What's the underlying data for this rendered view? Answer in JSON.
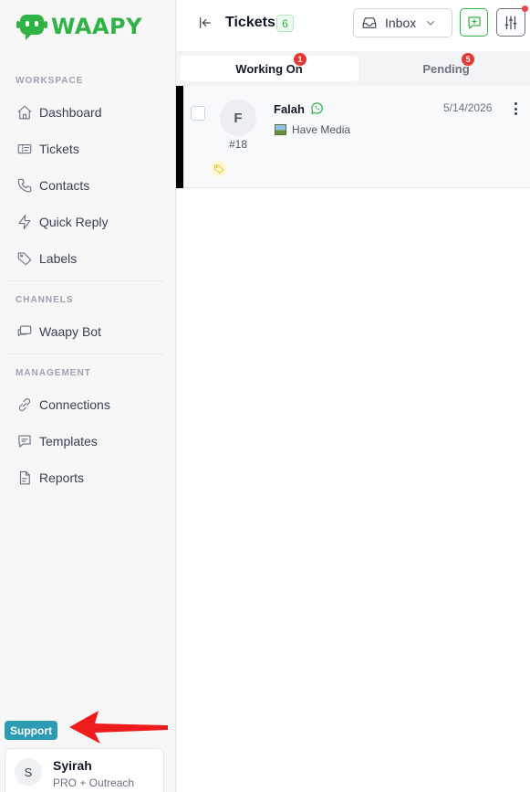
{
  "app": {
    "logo_text": "WAAPY",
    "brand_color": "#2fb344"
  },
  "sidebar": {
    "sections": {
      "workspace": "WORKSPACE",
      "channels": "CHANNELS",
      "management": "MANAGEMENT"
    },
    "items": [
      {
        "label": "Dashboard",
        "icon": "home-icon"
      },
      {
        "label": "Tickets",
        "icon": "ticket-icon"
      },
      {
        "label": "Contacts",
        "icon": "phone-icon"
      },
      {
        "label": "Quick Reply",
        "icon": "lightning-icon"
      },
      {
        "label": "Labels",
        "icon": "tag-icon"
      },
      {
        "label": "Waapy Bot",
        "icon": "bot-chat-icon"
      },
      {
        "label": "Connections",
        "icon": "link-icon"
      },
      {
        "label": "Templates",
        "icon": "message-template-icon"
      },
      {
        "label": "Reports",
        "icon": "document-icon"
      }
    ],
    "support_label": "Support",
    "user": {
      "initial": "S",
      "name": "Syirah",
      "plan": "PRO + Outreach"
    }
  },
  "header": {
    "title": "Tickets",
    "count": "6",
    "inbox_label": "Inbox"
  },
  "tabs": [
    {
      "label": "Working On",
      "count": "1",
      "active": true
    },
    {
      "label": "Pending",
      "count": "5",
      "active": false
    }
  ],
  "tickets": [
    {
      "initial": "F",
      "id": "#18",
      "name": "Falah",
      "channel_icon": "whatsapp-icon",
      "preview": "Have Media",
      "date": "5/14/2026"
    }
  ],
  "colors": {
    "accent": "#2fb344",
    "badge_red": "#e53935",
    "support": "#2e9bb5",
    "arrow": "#ee1c1c"
  }
}
